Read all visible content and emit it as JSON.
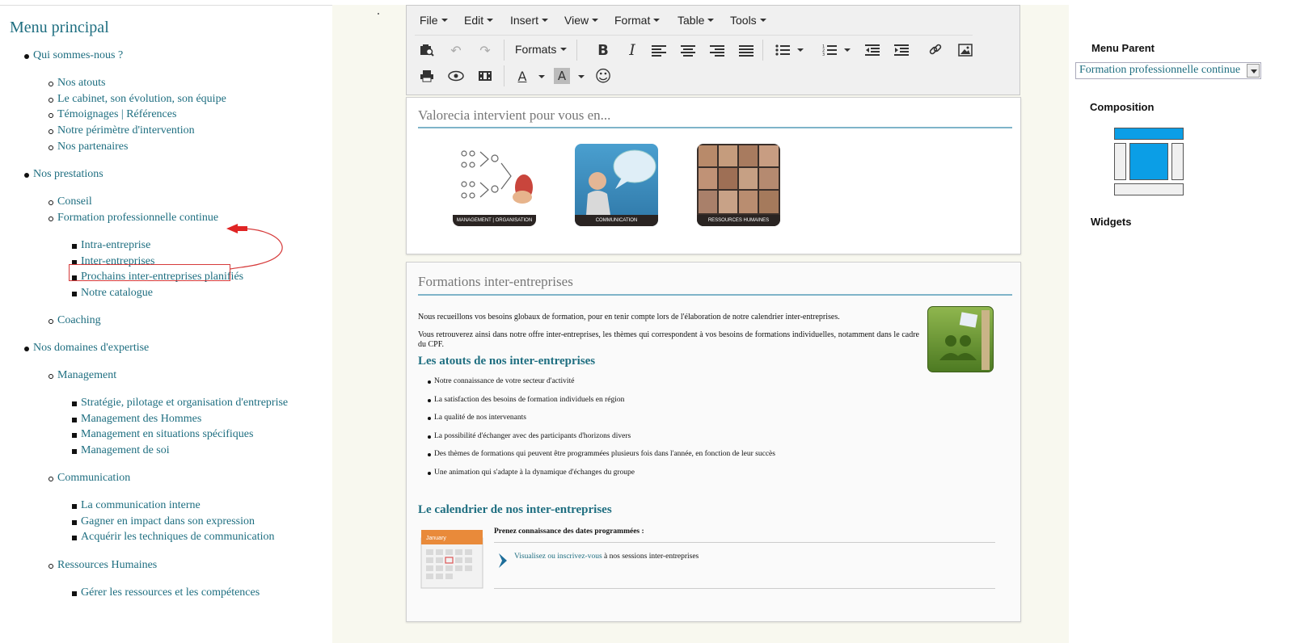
{
  "left_menu": {
    "title": "Menu principal",
    "items": [
      {
        "label": "Qui sommes-nous ?"
      },
      {
        "label": "Nos atouts"
      },
      {
        "label": "Le cabinet, son évolution, son équipe"
      },
      {
        "label": "Témoignages | Références"
      },
      {
        "label": "Notre périmètre d'intervention"
      },
      {
        "label": "Nos partenaires"
      },
      {
        "label": "Nos prestations"
      },
      {
        "label": "Conseil"
      },
      {
        "label": "Formation professionnelle continue"
      },
      {
        "label": "Intra-entreprise"
      },
      {
        "label": "Inter-entreprises"
      },
      {
        "label": "Prochains inter-entreprises planifiés"
      },
      {
        "label": "Notre catalogue"
      },
      {
        "label": "Coaching"
      },
      {
        "label": "Nos domaines d'expertise"
      },
      {
        "label": "Management"
      },
      {
        "label": "Stratégie, pilotage et organisation d'entreprise"
      },
      {
        "label": "Management des Hommes"
      },
      {
        "label": "Management en situations spécifiques"
      },
      {
        "label": "Management de soi"
      },
      {
        "label": "Communication"
      },
      {
        "label": "La communication interne"
      },
      {
        "label": "Gagner en impact dans son expression"
      },
      {
        "label": "Acquérir les techniques de communication"
      },
      {
        "label": "Ressources Humaines"
      },
      {
        "label": "Gérer les ressources et les compétences"
      }
    ]
  },
  "editor": {
    "menubar": [
      "File",
      "Edit",
      "Insert",
      "View",
      "Format",
      "Table",
      "Tools"
    ],
    "formats_label": "Formats",
    "toolbar_glyphs": {
      "bold": "B",
      "italic": "I",
      "text_color": "A",
      "bg_color": "A",
      "emoji": "☺",
      "undo": "↶",
      "redo": "↷",
      "print": "⎙",
      "preview": "◉",
      "link": "🔗"
    }
  },
  "block1": {
    "heading": "Valorecia intervient pour vous en...",
    "thumbs": [
      {
        "caption": "MANAGEMENT | ORGANISATION"
      },
      {
        "caption": "COMMUNICATION"
      },
      {
        "caption": "RESSOURCES HUMAINES"
      }
    ]
  },
  "block2": {
    "heading": "Formations inter-entreprises",
    "para1": "Nous recueillons vos besoins globaux de formation, pour en tenir compte lors de l'élaboration de notre calendrier inter-entreprises.",
    "para2": "Vous retrouverez ainsi dans notre offre inter-entreprises, les thèmes qui correspondent à vos besoins de formations individuelles, notamment dans le cadre du CPF.",
    "h_atouts": "Les atouts de nos inter-entreprises",
    "atouts": [
      "Notre connaissance de votre secteur d'activité",
      "La satisfaction des besoins de formation individuels en région",
      "La qualité de nos intervenants",
      "La possibilité d'échanger avec des participants d'horizons divers",
      "Des thèmes de formations qui peuvent être programmées plusieurs fois dans l'année, en fonction de leur succès",
      "Une animation qui s'adapte à la dynamique d'échanges du groupe"
    ],
    "h_calendrier": "Le calendrier de nos inter-entreprises",
    "calendar_intro": "Prenez connaissance des dates programmées :",
    "calendar_link": "Visualisez ou inscrivez-vous",
    "calendar_rest": " à nos sessions inter-entreprises",
    "calendar_month": "January"
  },
  "right_panel": {
    "menu_parent_label": "Menu Parent",
    "menu_parent_value": "Formation professionnelle continue",
    "composition_label": "Composition",
    "widgets_label": "Widgets",
    "accent": "#0b9ee6"
  }
}
